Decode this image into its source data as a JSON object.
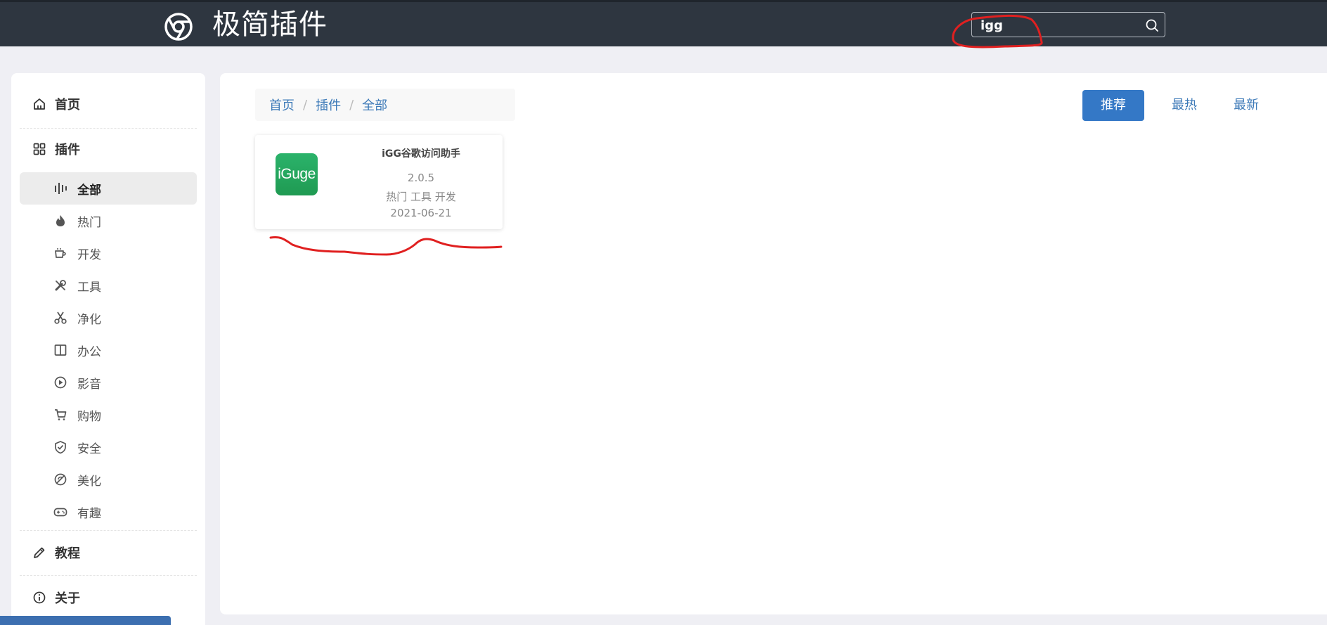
{
  "header": {
    "title": "极简插件",
    "logo_icon": "chrome-icon",
    "search": {
      "value": "igg",
      "icon": "search-icon"
    }
  },
  "sidebar": {
    "home": {
      "label": "首页",
      "icon": "home-icon"
    },
    "plugins": {
      "label": "插件",
      "icon": "grid-icon"
    },
    "categories": [
      {
        "label": "全部",
        "icon": "bars-icon",
        "active": true
      },
      {
        "label": "热门",
        "icon": "fire-icon"
      },
      {
        "label": "开发",
        "icon": "cup-icon"
      },
      {
        "label": "工具",
        "icon": "tools-icon"
      },
      {
        "label": "净化",
        "icon": "scissors-icon"
      },
      {
        "label": "办公",
        "icon": "book-icon"
      },
      {
        "label": "影音",
        "icon": "play-icon"
      },
      {
        "label": "购物",
        "icon": "cart-icon"
      },
      {
        "label": "安全",
        "icon": "shield-icon"
      },
      {
        "label": "美化",
        "icon": "palette-icon"
      },
      {
        "label": "有趣",
        "icon": "gamepad-icon"
      }
    ],
    "tutorial": {
      "label": "教程",
      "icon": "pencil-icon"
    },
    "about": {
      "label": "关于",
      "icon": "info-icon"
    }
  },
  "main": {
    "breadcrumb": [
      "首页",
      "插件",
      "全部"
    ],
    "sort_tabs": [
      {
        "label": "推荐",
        "active": true
      },
      {
        "label": "最热"
      },
      {
        "label": "最新"
      }
    ],
    "results": [
      {
        "logo_text": "iGuge",
        "name": "iGG谷歌访问助手",
        "version": "2.0.5",
        "tags": "热门 工具 开发",
        "date": "2021-06-21"
      }
    ]
  },
  "annotation_color": "#e02020",
  "accent_color": "#3478c6",
  "header_color": "#2e3640"
}
